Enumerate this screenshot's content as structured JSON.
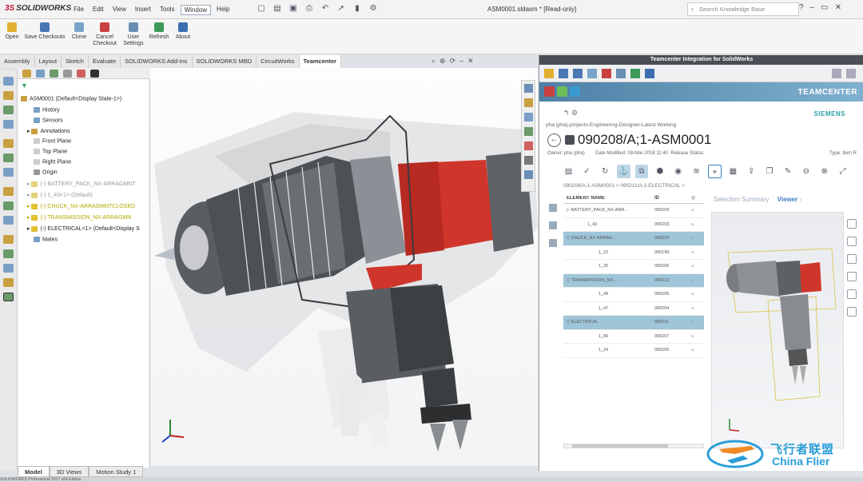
{
  "app": {
    "brand": "SOLIDWORKS",
    "menu": [
      "File",
      "Edit",
      "View",
      "Insert",
      "Tools",
      "Window",
      "Help"
    ],
    "doc_title": "ASM0001.sldasm * [Read-only]",
    "search_placeholder": "Search Knowledge Base"
  },
  "ribbon": {
    "buttons": [
      "Open",
      "Save Checkouts",
      "Clone",
      "Cancel Checkout",
      "User Settings",
      "Refresh",
      "About"
    ]
  },
  "command_tabs": [
    "Assembly",
    "Layout",
    "Sketch",
    "Evaluate",
    "SOLIDWORKS Add-Ins",
    "SOLIDWORKS MBD",
    "CircuitWorks",
    "Teamcenter"
  ],
  "feature_tree": {
    "root": "ASM0001 (Default<Display State-1>)",
    "items": [
      "History",
      "Sensors",
      "Annotations",
      "Front Plane",
      "Top Plane",
      "Right Plane",
      "Origin"
    ],
    "components": [
      "(-) BATTERY_PACK_NX-ARRAGMNT",
      "(-) 1_43<1> (Default)",
      "(-) CHUCK_NX-ARRAGMNTCLOSED",
      "(-) TRANSMISSION_NX-ARRAGMN",
      "(-) ELECTRICAL<1> (Default<Display S"
    ],
    "mates": "Mates"
  },
  "bottom_tabs": [
    "Model",
    "3D Views",
    "Motion Study 1"
  ],
  "status_text": "SOLIDWORKS Professional 2017 x64 Edition",
  "teamcenter": {
    "panel_title": "Teamcenter Integration for SolidWorks",
    "brand": "TEAMCENTER",
    "vendor": "SIEMENS",
    "path": "pha (pha)-projects-Engineering-Designer-Latest Working",
    "item_title": "090208/A;1-ASM0001",
    "owner": "Owner: pha (pha)",
    "date_modified": "Date Modified: 08-Mar-2018 11:40",
    "release_status": "Release Status:",
    "type": "Type: Item R",
    "breadcrumb": "090208/A;1-ASM0001  >  090211/A;1-ELECTRICAL  >",
    "columns": [
      "ELEMENT NAME",
      "ID"
    ],
    "rows": [
      {
        "name": "BATTERY_PACK_NX-ARR...",
        "id": "090209"
      },
      {
        "name": "1_43",
        "id": "090203"
      },
      {
        "name": "CHUCK_NX-ARRAG...",
        "id": "090210"
      },
      {
        "name": "1_22",
        "id": "090199"
      },
      {
        "name": "1_35",
        "id": "090206"
      },
      {
        "name": "TRANSMISSION_NX...",
        "id": "090212"
      },
      {
        "name": "1_49",
        "id": "090205"
      },
      {
        "name": "1_47",
        "id": "090204"
      },
      {
        "name": "ELECTRICAL",
        "id": "090211"
      },
      {
        "name": "1_80",
        "id": "090207"
      },
      {
        "name": "1_24",
        "id": "090200"
      }
    ],
    "tab_summary": "Selection Summary",
    "tab_viewer": "Viewer"
  },
  "watermark": {
    "cn": "飞行者联盟",
    "en": "China Flier"
  },
  "colors": {
    "accent": "#4f7fa5",
    "highlight": "#9fc5d9",
    "motor_red": "#d0352b"
  }
}
